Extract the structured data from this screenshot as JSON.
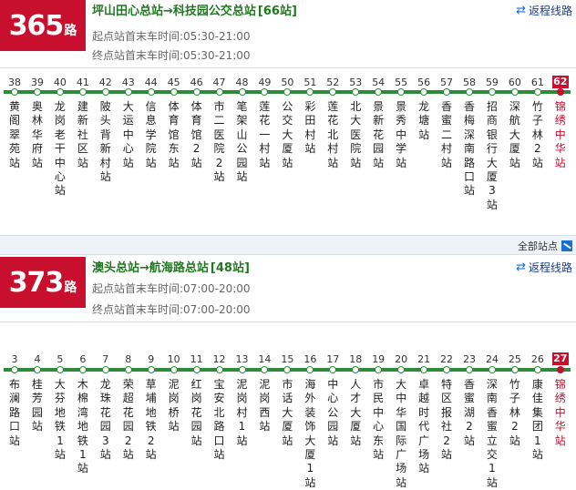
{
  "routes": [
    {
      "number": "365",
      "suffix": "路",
      "title": "坪山田心总站→科技园公交总站",
      "stop_count": "[66站]",
      "first_bus": "起点站首末车时间:05:30-21:00",
      "last_bus": "终点站首末车时间:05:30-21:00",
      "return_label": "返程线路",
      "stops": [
        {
          "num": "38",
          "name": "黄阁翠苑站"
        },
        {
          "num": "39",
          "name": "奥林华府站"
        },
        {
          "num": "40",
          "name": "龙岗老干中心站"
        },
        {
          "num": "41",
          "name": "建新社区站"
        },
        {
          "num": "42",
          "name": "陂头背新村站"
        },
        {
          "num": "43",
          "name": "大运中心站"
        },
        {
          "num": "44",
          "name": "信息学院站"
        },
        {
          "num": "45",
          "name": "体育馆东站"
        },
        {
          "num": "46",
          "name": "体育馆2站"
        },
        {
          "num": "47",
          "name": "市二医院2站"
        },
        {
          "num": "48",
          "name": "笔架山公园站"
        },
        {
          "num": "49",
          "name": "莲花一村站"
        },
        {
          "num": "50",
          "name": "公交大厦站"
        },
        {
          "num": "51",
          "name": "彩田村站"
        },
        {
          "num": "52",
          "name": "莲花北村站"
        },
        {
          "num": "53",
          "name": "北大医院站"
        },
        {
          "num": "54",
          "name": "景新花园站"
        },
        {
          "num": "55",
          "name": "景秀中学站"
        },
        {
          "num": "56",
          "name": "龙塘站"
        },
        {
          "num": "57",
          "name": "香蜜二村站"
        },
        {
          "num": "58",
          "name": "香梅深南路口站"
        },
        {
          "num": "59",
          "name": "招商银行大厦3站"
        },
        {
          "num": "60",
          "name": "深航大厦站"
        },
        {
          "num": "61",
          "name": "竹子林2站"
        },
        {
          "num": "62",
          "name": "锦绣中华站",
          "current": true
        }
      ]
    },
    {
      "number": "373",
      "suffix": "路",
      "title": "澳头总站→航海路总站",
      "stop_count": "[48站]",
      "first_bus": "起点站首末车时间:07:00-20:00",
      "last_bus": "终点站首末车时间:07:00-20:00",
      "return_label": "返程线路",
      "stops": [
        {
          "num": "3",
          "name": "布澜路口站"
        },
        {
          "num": "4",
          "name": "桂芳园站"
        },
        {
          "num": "5",
          "name": "大芬地铁1站"
        },
        {
          "num": "6",
          "name": "木棉湾地铁1站"
        },
        {
          "num": "7",
          "name": "龙珠花园3站"
        },
        {
          "num": "8",
          "name": "荣超花园2站"
        },
        {
          "num": "9",
          "name": "草埔地铁2站"
        },
        {
          "num": "10",
          "name": "泥岗桥站"
        },
        {
          "num": "11",
          "name": "红岗花园站"
        },
        {
          "num": "12",
          "name": "宝安北路口站"
        },
        {
          "num": "13",
          "name": "泥岗村1站"
        },
        {
          "num": "14",
          "name": "泥岗西站"
        },
        {
          "num": "15",
          "name": "市话大厦站"
        },
        {
          "num": "16",
          "name": "海外装饰大厦1站"
        },
        {
          "num": "17",
          "name": "中心公园站"
        },
        {
          "num": "18",
          "name": "人才大厦站"
        },
        {
          "num": "19",
          "name": "市民中心东站"
        },
        {
          "num": "20",
          "name": "大中华国际广场站"
        },
        {
          "num": "21",
          "name": "卓越时代广场站"
        },
        {
          "num": "22",
          "name": "特区报社2站"
        },
        {
          "num": "23",
          "name": "香蜜湖2站"
        },
        {
          "num": "24",
          "name": "深南香蜜立交1站"
        },
        {
          "num": "25",
          "name": "竹子林2站"
        },
        {
          "num": "26",
          "name": "康佳集团1站"
        },
        {
          "num": "27",
          "name": "锦绣中华站",
          "current": true
        }
      ]
    }
  ],
  "all_stops_label": "全部站点"
}
